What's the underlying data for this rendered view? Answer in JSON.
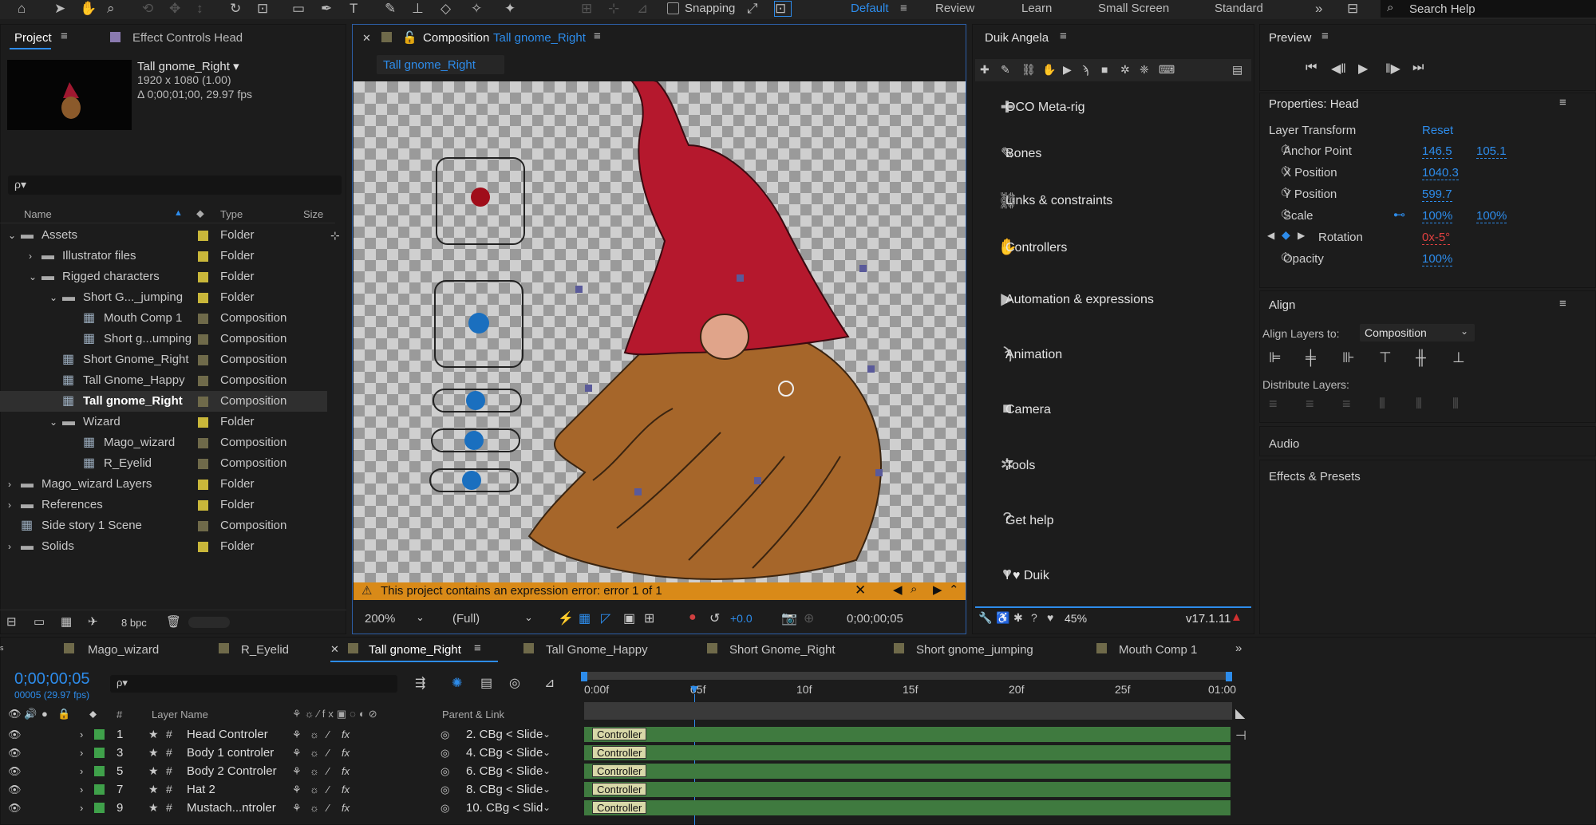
{
  "toolbar": {
    "snapping": "Snapping",
    "workspaces": [
      "Default",
      "Review",
      "Learn",
      "Small Screen",
      "Standard"
    ],
    "search": "Search Help"
  },
  "project": {
    "tab": "Project",
    "tab2": "Effect Controls Head",
    "comp_name": "Tall gnome_Right ▾",
    "comp_size": "1920 x 1080 (1.00)",
    "comp_duration": "Δ 0;00;01;00, 29.97 fps",
    "search_placeholder": "ρ▾",
    "col_name": "Name",
    "col_type": "Type",
    "col_size": "Size",
    "rows": [
      {
        "name": "Assets",
        "type": "Folder"
      },
      {
        "name": "Illustrator files",
        "type": "Folder"
      },
      {
        "name": "Rigged characters",
        "type": "Folder"
      },
      {
        "name": "Short G..._jumping",
        "type": "Folder"
      },
      {
        "name": "Mouth Comp 1",
        "type": "Composition"
      },
      {
        "name": "Short g...umping",
        "type": "Composition"
      },
      {
        "name": "Short Gnome_Right",
        "type": "Composition"
      },
      {
        "name": "Tall Gnome_Happy",
        "type": "Composition"
      },
      {
        "name": "Tall gnome_Right",
        "type": "Composition"
      },
      {
        "name": "Wizard",
        "type": "Folder"
      },
      {
        "name": "Mago_wizard",
        "type": "Composition"
      },
      {
        "name": "R_Eyelid",
        "type": "Composition"
      },
      {
        "name": "Mago_wizard Layers",
        "type": "Folder"
      },
      {
        "name": "References",
        "type": "Folder"
      },
      {
        "name": "Side story 1 Scene",
        "type": "Composition"
      },
      {
        "name": "Solids",
        "type": "Folder"
      }
    ],
    "bpc": "8 bpc"
  },
  "comp": {
    "title_prefix": "Composition",
    "title_name": "Tall gnome_Right",
    "subtab": "Tall gnome_Right",
    "error": "This project contains an expression error: error 1 of 1",
    "zoom": "200%",
    "quality": "(Full)",
    "exposure": "+0.0",
    "timecode": "0;00;00;05"
  },
  "duik": {
    "title": "Duik Angela",
    "items": [
      "OCO Meta-rig",
      "Bones",
      "Links & constraints",
      "Controllers",
      "Automation & expressions",
      "Animation",
      "Camera",
      "Tools",
      "Get help",
      "I ♥ Duik"
    ],
    "percent": "45%",
    "version": "v17.1.11"
  },
  "preview": {
    "title": "Preview"
  },
  "properties": {
    "title": "Properties: Head",
    "section": "Layer Transform",
    "reset": "Reset",
    "anchor_label": "Anchor Point",
    "anchor_x": "146.5",
    "anchor_y": "105.1",
    "xpos_label": "X Position",
    "xpos": "1040.3",
    "ypos_label": "Y Position",
    "ypos": "599.7",
    "scale_label": "Scale",
    "scale_x": "100%",
    "scale_y": "100%",
    "rot_label": "Rotation",
    "rot": "0x-5°",
    "opacity_label": "Opacity",
    "opacity": "100%"
  },
  "align": {
    "title": "Align",
    "align_to_label": "Align Layers to:",
    "align_to": "Composition",
    "distribute": "Distribute Layers:"
  },
  "audio": "Audio",
  "effects": "Effects & Presets",
  "timeline": {
    "tabs": [
      "Mago_wizard",
      "R_Eyelid",
      "Tall gnome_Right",
      "Tall Gnome_Happy",
      "Short Gnome_Right",
      "Short gnome_jumping",
      "Mouth Comp 1"
    ],
    "timecode": "0;00;00;05",
    "frames": "00005 (29.97 fps)",
    "col_layer": "Layer Name",
    "col_parent": "Parent & Link",
    "col_hash": "#",
    "ruler": [
      "0:00f",
      "05f",
      "10f",
      "15f",
      "20f",
      "25f",
      "01:00"
    ],
    "layers": [
      {
        "num": "1",
        "name": "Head Controler",
        "parent": "2. CBg < Slide"
      },
      {
        "num": "3",
        "name": "Body 1 controler",
        "parent": "4. CBg < Slide"
      },
      {
        "num": "5",
        "name": "Body 2 Controler",
        "parent": "6. CBg < Slide"
      },
      {
        "num": "7",
        "name": "Hat 2",
        "parent": "8. CBg < Slide"
      },
      {
        "num": "9",
        "name": "Mustach...ntroler",
        "parent": "10. CBg < Slid"
      }
    ],
    "bar_label": "Controller"
  }
}
